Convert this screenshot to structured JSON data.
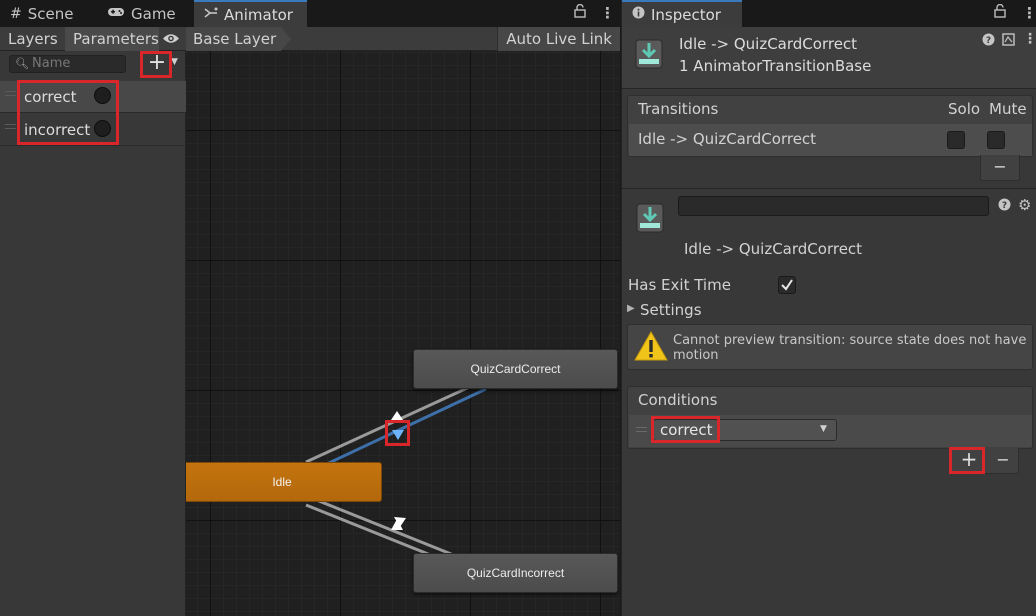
{
  "left_tabs": {
    "scene": "Scene",
    "game": "Game",
    "animator": "Animator"
  },
  "animator": {
    "subtabs": {
      "layers": "Layers",
      "parameters": "Parameters"
    },
    "search_placeholder": "Name",
    "add_symbol": "+",
    "parameters": [
      {
        "name": "correct"
      },
      {
        "name": "incorrect"
      }
    ],
    "breadcrumb": "Base Layer",
    "auto_live_link": "Auto Live Link",
    "states": {
      "quiz_correct": "QuizCardCorrect",
      "idle": "Idle",
      "quiz_incorrect": "QuizCardIncorrect"
    }
  },
  "inspector": {
    "tab_label": "Inspector",
    "header_title": "Idle -> QuizCardCorrect",
    "header_subtitle": "1 AnimatorTransitionBase",
    "transitions": {
      "title": "Transitions",
      "solo": "Solo",
      "mute": "Mute",
      "row": "Idle -> QuizCardCorrect",
      "remove_symbol": "−"
    },
    "transition_detail": {
      "name_value": "",
      "label": "Idle -> QuizCardCorrect"
    },
    "has_exit_time": {
      "label": "Has Exit Time",
      "checked": true
    },
    "settings_label": "Settings",
    "warning": "Cannot preview transition: source state does not have motion",
    "conditions": {
      "title": "Conditions",
      "selected": "correct",
      "add_symbol": "+",
      "remove_symbol": "−"
    }
  },
  "colors": {
    "accent_blue": "#3a79bb",
    "state_orange": "#c4740e",
    "highlight_red": "#d8262a",
    "transition_selected": "#4a8fe0",
    "warning_yellow": "#f0c419",
    "teal_icon": "#5fc9b5"
  }
}
